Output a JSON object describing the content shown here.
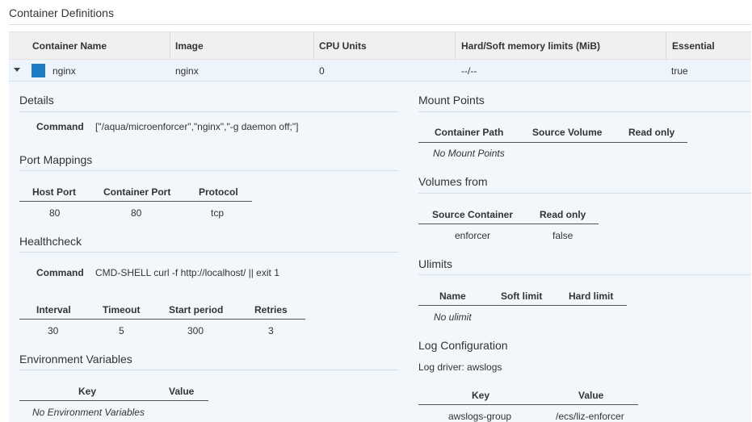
{
  "page_title": "Container Definitions",
  "table": {
    "headers": [
      "Container Name",
      "Image",
      "CPU Units",
      "Hard/Soft memory limits (MiB)",
      "Essential"
    ],
    "row": {
      "name": "nginx",
      "image": "nginx",
      "cpu": "0",
      "memory": "--/--",
      "essential": "true",
      "swatch_color": "#1d7cc4"
    }
  },
  "details": {
    "title": "Details",
    "command_label": "Command",
    "command_value": "[\"/aqua/microenforcer\",\"nginx\",\"-g daemon off;\"]"
  },
  "port_mappings": {
    "title": "Port Mappings",
    "headers": [
      "Host Port",
      "Container Port",
      "Protocol"
    ],
    "rows": [
      [
        "80",
        "80",
        "tcp"
      ]
    ]
  },
  "healthcheck": {
    "title": "Healthcheck",
    "command_label": "Command",
    "command_value": "CMD-SHELL curl -f http://localhost/ || exit 1",
    "headers": [
      "Interval",
      "Timeout",
      "Start period",
      "Retries"
    ],
    "rows": [
      [
        "30",
        "5",
        "300",
        "3"
      ]
    ]
  },
  "environment": {
    "title": "Environment Variables",
    "headers": [
      "Key",
      "Value"
    ],
    "empty": "No Environment Variables"
  },
  "mount_points": {
    "title": "Mount Points",
    "headers": [
      "Container Path",
      "Source Volume",
      "Read only"
    ],
    "empty": "No Mount Points"
  },
  "volumes_from": {
    "title": "Volumes from",
    "headers": [
      "Source Container",
      "Read only"
    ],
    "rows": [
      [
        "enforcer",
        "false"
      ]
    ]
  },
  "ulimits": {
    "title": "Ulimits",
    "headers": [
      "Name",
      "Soft limit",
      "Hard limit"
    ],
    "empty": "No ulimit"
  },
  "log_configuration": {
    "title": "Log Configuration",
    "driver_text": "Log driver: awslogs",
    "headers": [
      "Key",
      "Value"
    ],
    "rows": [
      [
        "awslogs-group",
        "/ecs/liz-enforcer"
      ]
    ]
  }
}
